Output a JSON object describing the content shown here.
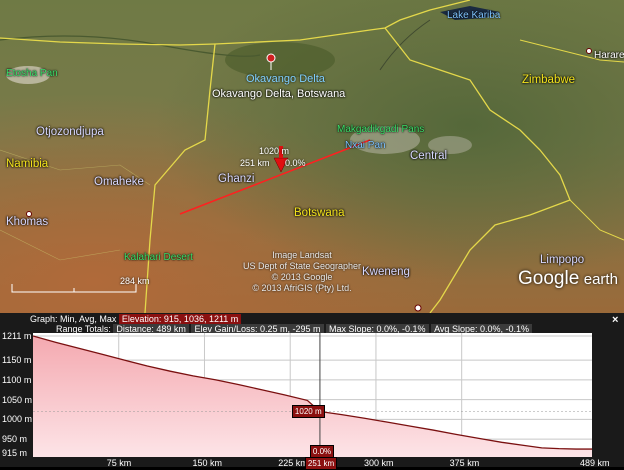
{
  "map": {
    "places": {
      "lake_kariba": "Lake Kariba",
      "harare": "Harare",
      "zimbabwe": "Zimbabwe",
      "etosha": "Etosha Pan",
      "okavango_link": "Okavango Delta",
      "okavango_label": "Okavango Delta, Botswana",
      "otjozondjupa": "Otjozondjupa",
      "namibia": "Namibia",
      "omaheke": "Omaheke",
      "ghanzi": "Ghanzi",
      "khomas": "Khomas",
      "botswana": "Botswana",
      "makgadikgadi": "Makgadikgadi Pans",
      "nxai_pan": "Nxai Pan",
      "central": "Central",
      "kalahari": "Kalahari Desert",
      "kweneng": "Kweneng",
      "limpopo": "Limpopo"
    },
    "path_readout": {
      "elevation": "1020 m",
      "distance": "251 km",
      "slope": "0.0%"
    },
    "scale_bar": "284 km",
    "credits": [
      "Image Landsat",
      "US Dept of State Geographer",
      "© 2013 Google",
      "© 2013 AfriGIS (Pty) Ltd."
    ],
    "logo": {
      "google": "Google",
      "earth": "earth"
    }
  },
  "profile": {
    "graph_label": "Graph: Min, Avg, Max",
    "elevation_stat": "Elevation: 915, 1036, 1211 m",
    "range_label": "Range Totals:",
    "distance_stat": "Distance: 489 km",
    "gain_stat": "Elev Gain/Loss: 0.25 m, -295 m",
    "max_slope_stat": "Max Slope: 0.0%, -0.1%",
    "avg_slope_stat": "Avg Slope: 0.0%, -0.1%",
    "close": "×",
    "cursor": {
      "elevation": "1020 m",
      "distance": "251 km",
      "slope": "0.0%"
    }
  },
  "chart_data": {
    "type": "area",
    "xlabel": "",
    "ylabel": "",
    "xlim": [
      0,
      489
    ],
    "ylim": [
      915,
      1211
    ],
    "y_ticks": [
      "1211 m",
      "1150 m",
      "1100 m",
      "1050 m",
      "1000 m",
      "950 m",
      "915 m"
    ],
    "y_tick_values": [
      1211,
      1150,
      1100,
      1050,
      1000,
      950,
      915
    ],
    "x_ticks": [
      "75 km",
      "150 km",
      "225 km",
      "300 km",
      "375 km",
      "489 km"
    ],
    "x_tick_values": [
      75,
      150,
      225,
      300,
      375,
      489
    ],
    "series": [
      {
        "x": [
          0,
          20,
          40,
          60,
          80,
          100,
          120,
          140,
          160,
          180,
          200,
          220,
          240,
          251,
          270,
          290,
          310,
          330,
          350,
          370,
          390,
          410,
          430,
          445,
          460,
          475,
          489
        ],
        "y": [
          1211,
          1195,
          1180,
          1165,
          1150,
          1135,
          1122,
          1110,
          1100,
          1088,
          1075,
          1062,
          1048,
          1020,
          1012,
          1003,
          993,
          983,
          973,
          962,
          952,
          942,
          934,
          928,
          926,
          925,
          925
        ]
      }
    ],
    "grid": true,
    "colors": {
      "line": "#7a1010",
      "fill": "#f4a9b0",
      "fill_bottom": "#fde4e7"
    }
  }
}
